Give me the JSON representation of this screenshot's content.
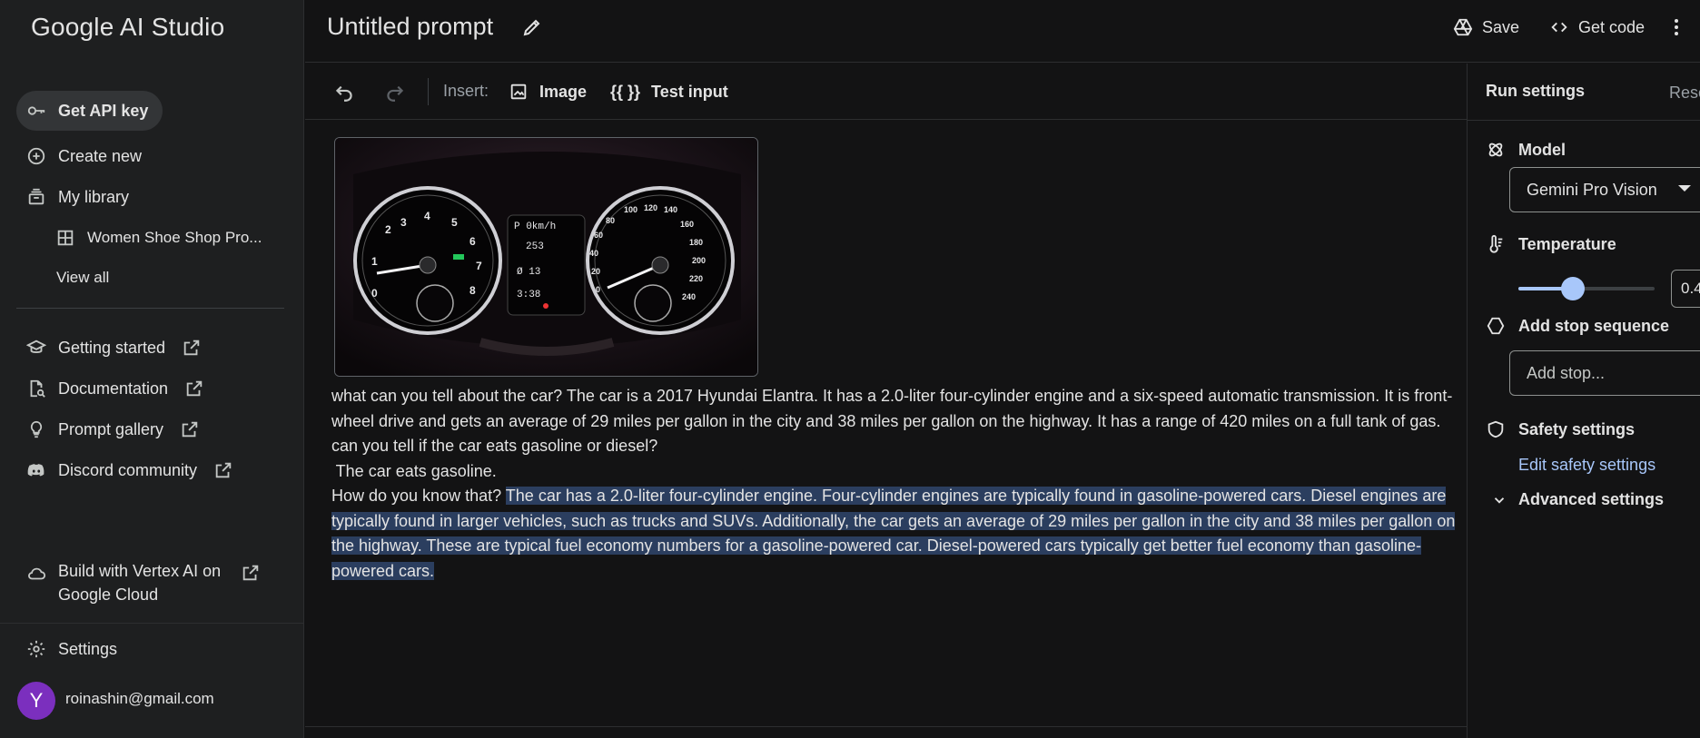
{
  "app": {
    "title": "Google AI Studio"
  },
  "sidebar": {
    "get_api_key": "Get API key",
    "create_new": "Create new",
    "my_library": "My library",
    "library_item": "Women Shoe Shop Pro...",
    "view_all": "View all",
    "links": [
      {
        "label": "Getting started"
      },
      {
        "label": "Documentation"
      },
      {
        "label": "Prompt gallery"
      },
      {
        "label": "Discord community"
      }
    ],
    "vertex_line1": "Build with Vertex AI on",
    "vertex_line2": "Google Cloud",
    "settings": "Settings",
    "user": {
      "avatar_letter": "Y",
      "email": "roinashin@gmail.com",
      "avatar_color": "#7b2fbe"
    }
  },
  "header": {
    "title": "Untitled prompt",
    "save": "Save",
    "get_code": "Get code"
  },
  "toolbar": {
    "insert_label": "Insert:",
    "image": "Image",
    "test_input_glyph": "{{ }}",
    "test_input": "Test input"
  },
  "editor": {
    "image_alt": "car instrument cluster photo",
    "p1": "what can you tell about the car? The car is a 2017 Hyundai Elantra. It has a 2.0-liter four-cylinder engine and a six-speed automatic transmission. It is front-wheel drive and gets an average of 29 miles per gallon in the city and 38 miles per gallon on the highway. It has a range of 420 miles on a full tank of gas.",
    "p2": "can you tell if the car eats gasoline or diesel?",
    "p3": " The car eats gasoline.",
    "p4_plain": "How do you know that? ",
    "p4_selected": "The car has a 2.0-liter four-cylinder engine. Four-cylinder engines are typically found in gasoline-powered cars. Diesel engines are typically found in larger vehicles, such as trucks and SUVs. Additionally, the car gets an average of 29 miles per gallon in the city and 38 miles per gallon on the highway. These are typical fuel economy numbers for a gasoline-powered car. Diesel-powered cars typically get better fuel economy than gasoline-powered cars."
  },
  "run_settings": {
    "title": "Run settings",
    "reset": "Reset",
    "model_label": "Model",
    "model_value": "Gemini Pro Vision",
    "temperature_label": "Temperature",
    "temperature_value": "0.4",
    "temperature_fraction": 0.4,
    "stop_label": "Add stop sequence",
    "stop_placeholder": "Add stop...",
    "safety_label": "Safety settings",
    "edit_safety": "Edit safety settings",
    "advanced": "Advanced settings"
  },
  "colors": {
    "accent": "#a8c7fa",
    "selection": "#2b3e5f",
    "background": "#131314",
    "sidebar": "#1e1f20"
  }
}
